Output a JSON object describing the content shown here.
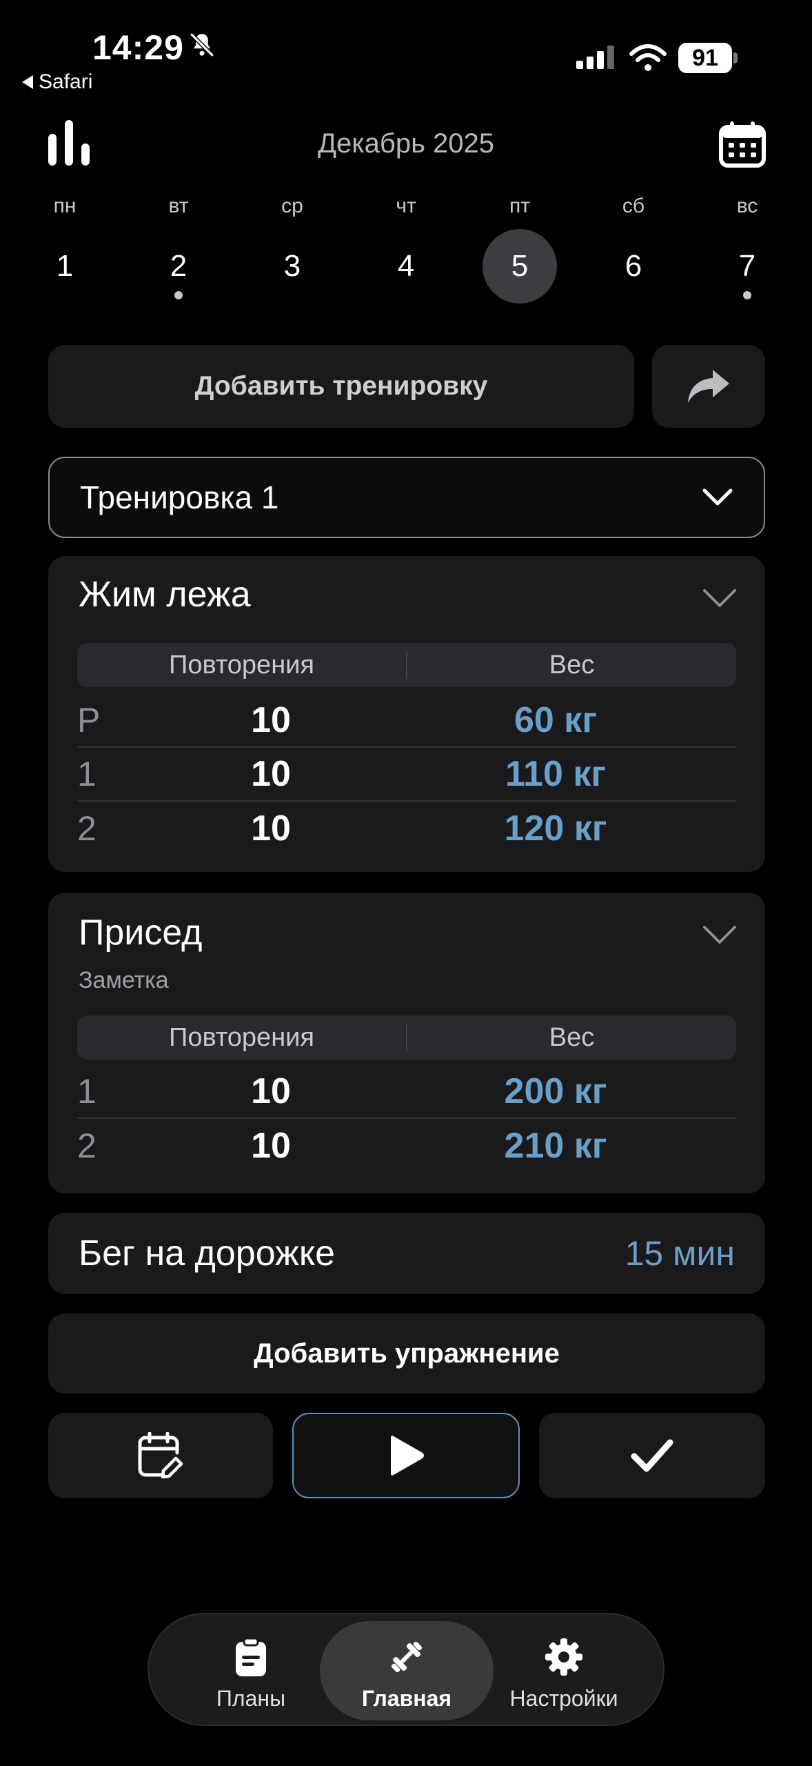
{
  "status_bar": {
    "time": "14:29",
    "back_label": "Safari",
    "battery": "91"
  },
  "header": {
    "title": "Декабрь 2025"
  },
  "week": [
    {
      "name": "пн",
      "num": "1",
      "dot": false,
      "active": false
    },
    {
      "name": "вт",
      "num": "2",
      "dot": true,
      "active": false
    },
    {
      "name": "ср",
      "num": "3",
      "dot": false,
      "active": false
    },
    {
      "name": "чт",
      "num": "4",
      "dot": false,
      "active": false
    },
    {
      "name": "пт",
      "num": "5",
      "dot": false,
      "active": true
    },
    {
      "name": "сб",
      "num": "6",
      "dot": false,
      "active": false
    },
    {
      "name": "вс",
      "num": "7",
      "dot": true,
      "active": false
    }
  ],
  "actions": {
    "add_workout": "Добавить тренировку"
  },
  "workout_select": {
    "value": "Тренировка 1"
  },
  "exercises": [
    {
      "title": "Жим лежа",
      "col_reps": "Повторения",
      "col_weight": "Вес",
      "sets": [
        {
          "idx": "Р",
          "reps": "10",
          "weight": "60 кг"
        },
        {
          "idx": "1",
          "reps": "10",
          "weight": "110 кг"
        },
        {
          "idx": "2",
          "reps": "10",
          "weight": "120 кг"
        }
      ]
    },
    {
      "title": "Присед",
      "note": "Заметка",
      "col_reps": "Повторения",
      "col_weight": "Вес",
      "sets": [
        {
          "idx": "1",
          "reps": "10",
          "weight": "200 кг"
        },
        {
          "idx": "2",
          "reps": "10",
          "weight": "210 кг"
        }
      ]
    }
  ],
  "cardio": {
    "name": "Бег на дорожке",
    "value": "15 мин"
  },
  "add_exercise": "Добавить упражнение",
  "tabbar": {
    "plans": "Планы",
    "home": "Главная",
    "settings": "Настройки"
  },
  "colors": {
    "accent_blue": "#6a9fc7",
    "card_bg": "#1a1a1c",
    "background": "#000000"
  }
}
